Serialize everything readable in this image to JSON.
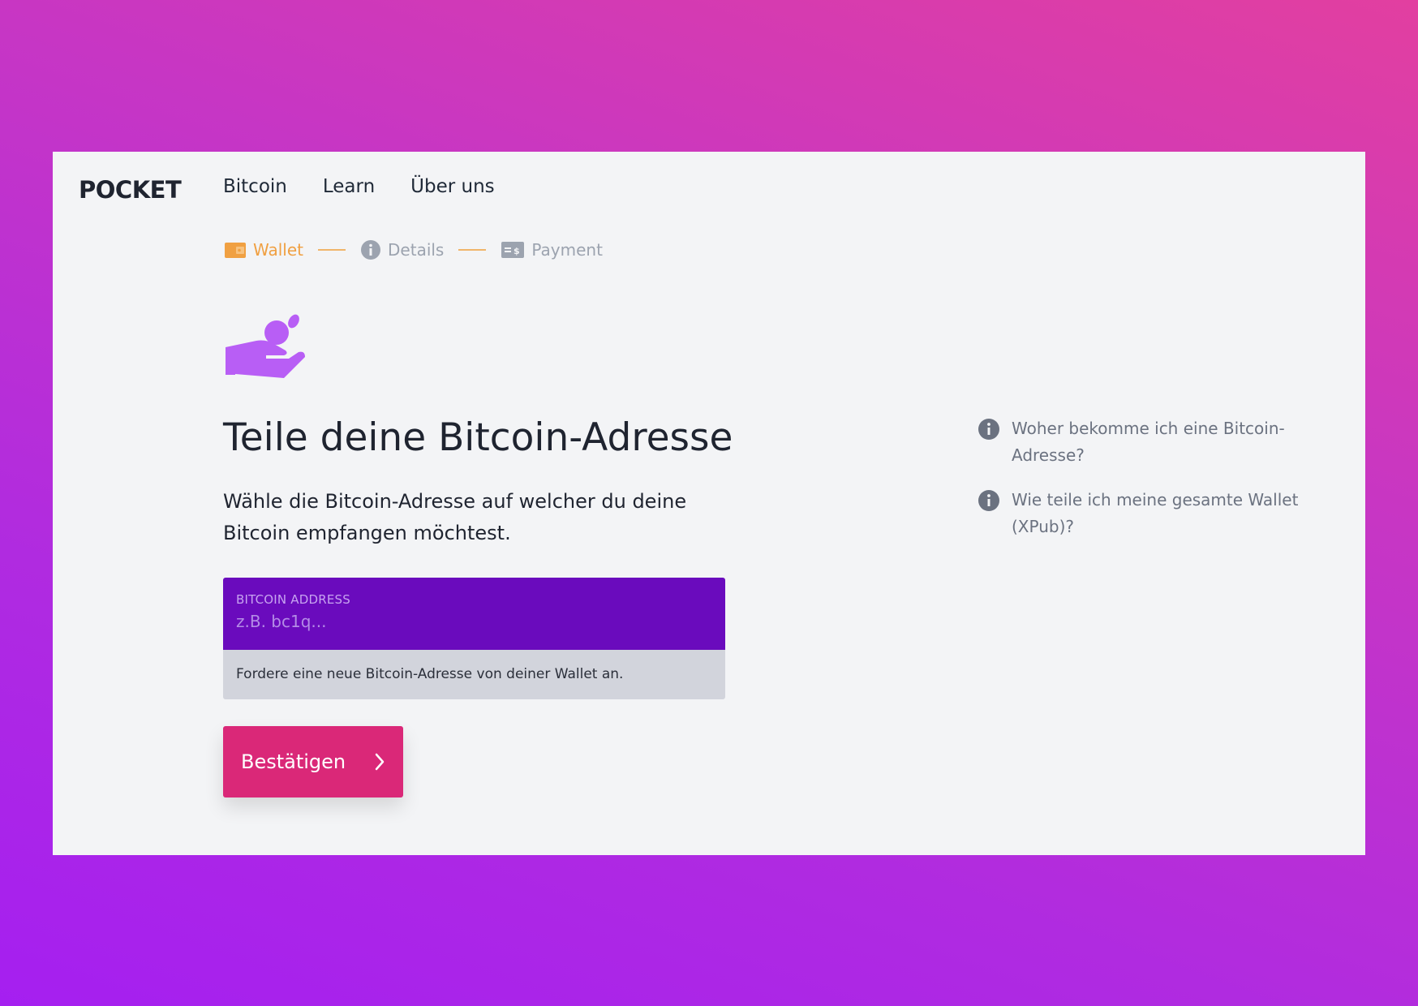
{
  "header": {
    "logo": "POCKET",
    "nav": [
      {
        "label": "Bitcoin"
      },
      {
        "label": "Learn"
      },
      {
        "label": "Über uns"
      }
    ]
  },
  "steps": [
    {
      "label": "Wallet",
      "icon": "wallet-icon",
      "state": "active"
    },
    {
      "label": "Details",
      "icon": "info-icon",
      "state": "inactive"
    },
    {
      "label": "Payment",
      "icon": "payment-card-icon",
      "state": "inactive"
    }
  ],
  "main": {
    "hero_icon": "hand-receive-coin-icon",
    "title": "Teile deine Bitcoin-Adresse",
    "subtitle": "Wähle die Bitcoin-Adresse auf welcher du deine Bitcoin empfangen möchtest.",
    "address_field": {
      "label": "BITCOIN ADDRESS",
      "placeholder": "z.B. bc1q...",
      "value": ""
    },
    "hint": "Fordere eine neue Bitcoin-Adresse von deiner Wallet an.",
    "confirm_label": "Bestätigen"
  },
  "help": [
    {
      "text": "Woher bekomme ich eine Bitcoin-Adresse?"
    },
    {
      "text": "Wie teile ich meine gesamte Wallet (XPub)?"
    }
  ],
  "colors": {
    "accent_orange": "#f0a042",
    "input_purple": "#6a0bbd",
    "button_pink": "#da2878",
    "icon_purple": "#b85ef5"
  }
}
